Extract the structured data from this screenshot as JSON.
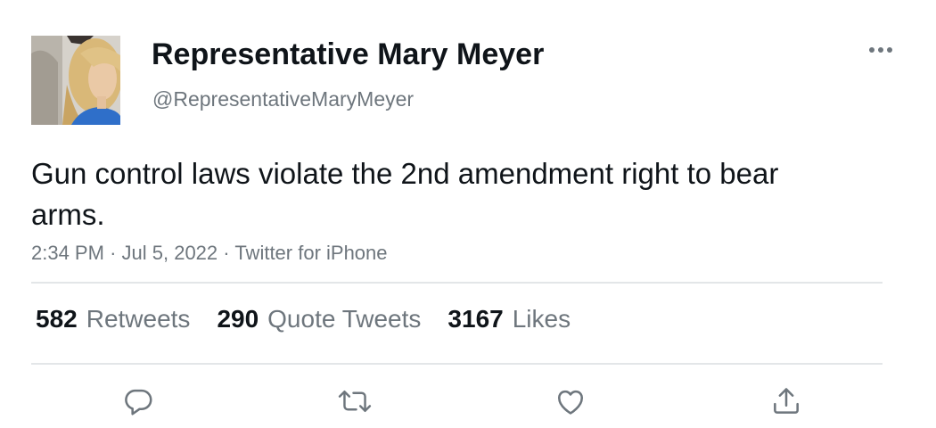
{
  "author": {
    "display_name": "Representative Mary Meyer",
    "handle": "@RepresentativeMaryMeyer",
    "avatar_icon": "profile-photo"
  },
  "tweet": {
    "text": "Gun control laws violate the 2nd amendment right to bear arms.",
    "time": "2:34 PM",
    "separator": "·",
    "date": "Jul 5, 2022",
    "source": "Twitter for iPhone"
  },
  "stats": {
    "retweets": {
      "count": "582",
      "label": "Retweets"
    },
    "quotes": {
      "count": "290",
      "label": "Quote Tweets"
    },
    "likes": {
      "count": "3167",
      "label": "Likes"
    }
  },
  "actions": {
    "reply_icon": "reply-icon",
    "retweet_icon": "retweet-icon",
    "like_icon": "like-icon",
    "share_icon": "share-icon"
  },
  "colors": {
    "text_primary": "#0f1419",
    "text_secondary": "#6e767d",
    "divider": "#e3e6e8"
  }
}
